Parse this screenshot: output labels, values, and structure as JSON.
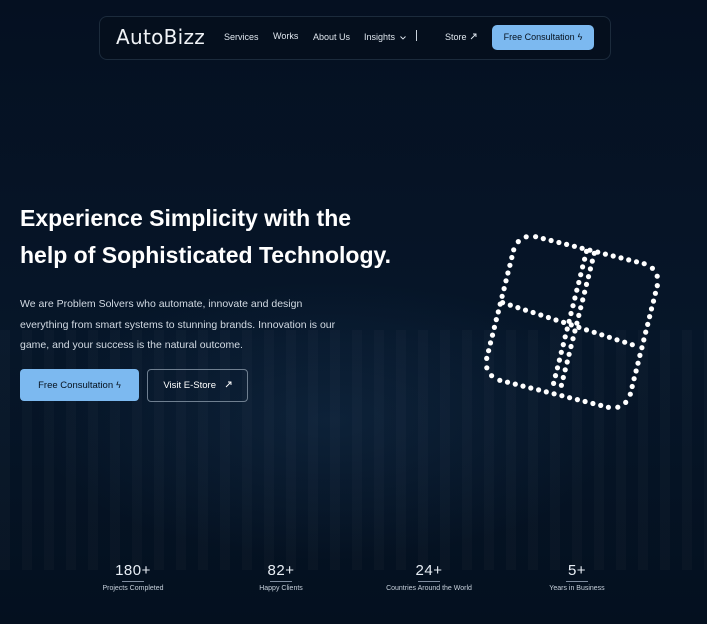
{
  "nav": {
    "logo": "AutoBizz",
    "items": [
      {
        "label": "Services"
      },
      {
        "label": "Works"
      },
      {
        "label": "About Us"
      },
      {
        "label": "Insights"
      }
    ],
    "store": "Store",
    "cta": "Free Consultation"
  },
  "hero": {
    "title_line1": "Experience Simplicity with the",
    "title_line2": "help of Sophisticated Technology.",
    "subtitle_line1": "We are Problem Solvers who automate, innovate and design",
    "subtitle_line2": "everything from smart systems to stunning brands. Innovation is our",
    "subtitle_line3": "game, and your success is the natural outcome.",
    "primary_button": "Free Consultation",
    "secondary_button": "Visit E-Store"
  },
  "stats": [
    {
      "value": "180+",
      "label": "Projects Completed"
    },
    {
      "value": "82+",
      "label": "Happy Clients"
    },
    {
      "value": "24+",
      "label": "Countries Around the World"
    },
    {
      "value": "5+",
      "label": "Years in Business"
    }
  ],
  "colors": {
    "background": "#04101f",
    "accent": "#7cb9f0",
    "text": "#ffffff"
  },
  "icons": {
    "nav_dropdown": "chevron-down-icon",
    "store": "external-link-icon",
    "cta": "lightning-icon",
    "logo_graphic": "dotted-window-icon"
  }
}
